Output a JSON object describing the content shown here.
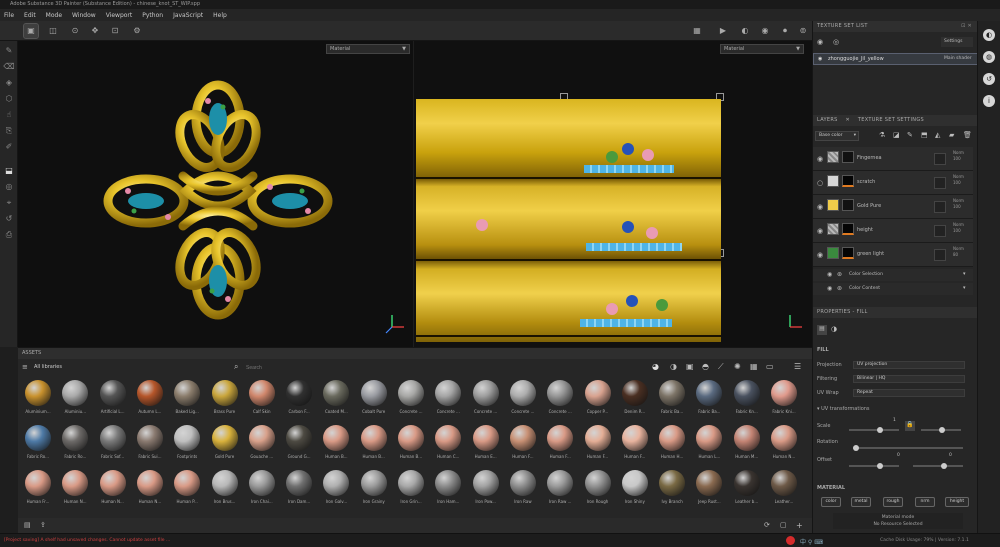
{
  "window": {
    "title": "Adobe Substance 3D Painter (Substance Edition) - chinese_knot_ST_WIP.spp"
  },
  "menu": [
    "File",
    "Edit",
    "Mode",
    "Window",
    "Viewport",
    "Python",
    "JavaScript",
    "Help"
  ],
  "viewport3d": {
    "dropdown": "Material"
  },
  "viewport2d": {
    "dropdown": "Material"
  },
  "assets": {
    "title": "ASSETS",
    "library": "All libraries",
    "search_placeholder": "Search",
    "rows": [
      [
        "Aluminium...",
        "Aluminiu...",
        "Artificial L...",
        "Autumn L...",
        "Baked Lig...",
        "Brass Pure",
        "Calf Skin",
        "Carbon F...",
        "Coated M...",
        "Cobalt Pure",
        "Concrete ...",
        "Concrete ...",
        "Concrete ...",
        "Concrete ...",
        "Concrete ...",
        "Copper P...",
        "Denim R...",
        "Fabric Ba...",
        "Fabric Ba...",
        "Fabric Kn...",
        "Fabric Kni..."
      ],
      [
        "Fabric Ro...",
        "Fabric Ro...",
        "Fabric Sof...",
        "Fabric Sui...",
        "Footprints",
        "Gold Pure",
        "Gouache ...",
        "Ground G...",
        "Human B...",
        "Human B...",
        "Human B...",
        "Human C...",
        "Human E...",
        "Human F...",
        "Human F...",
        "Human F...",
        "Human F...",
        "Human H...",
        "Human L...",
        "Human M...",
        "Human N..."
      ],
      [
        "Human Fr...",
        "Human N...",
        "Human N...",
        "Human N...",
        "Human P...",
        "Iron Brus...",
        "Iron Chai...",
        "Iron Dam...",
        "Iron Galv...",
        "Iron Grainy",
        "Iron Grin...",
        "Iron Ham...",
        "Iron Pow...",
        "Iron Raw",
        "Iron Raw ...",
        "Iron Rough",
        "Iron Shiny",
        "Ivy Branch",
        "Jeep Rust...",
        "Leather b...",
        "Leather..."
      ]
    ]
  },
  "texture_set_list": {
    "title": "TEXTURE SET LIST",
    "settings": "Settings",
    "item_name": "zhongguojie_Jil_yellow",
    "item_shader": "Main shader"
  },
  "layers": {
    "tab1": "LAYERS",
    "tab2": "TEXTURE SET SETTINGS",
    "channel": "Base color",
    "items": [
      {
        "name": "Fingernea",
        "blend": "Norm",
        "opacity": "100"
      },
      {
        "name": "scratch",
        "blend": "Norm",
        "opacity": "100"
      },
      {
        "name": "Gold Pure",
        "blend": "Norm",
        "opacity": "100"
      },
      {
        "name": "height",
        "blend": "Norm",
        "opacity": "100"
      },
      {
        "name": "green light",
        "blend": "Norm",
        "opacity": "80"
      }
    ],
    "effects": [
      "Color Selection",
      "Color Content"
    ]
  },
  "properties": {
    "tab": "PROPERTIES - FILL",
    "section": "FILL",
    "projection_label": "Projection",
    "projection_value": "UV projection",
    "filtering_label": "Filtering",
    "filtering_value": "Bilinear | HQ",
    "uvwrap_label": "UV Wrap",
    "uvwrap_value": "Repeat",
    "uvtrans": "UV transformations",
    "scale_label": "Scale",
    "scale_value": "1",
    "rotation_label": "Rotation",
    "offset_label": "Offset",
    "offset_x": "0",
    "offset_y": "0",
    "material": "MATERIAL",
    "mat_buttons": [
      "color",
      "metal",
      "rough",
      "nrm",
      "height"
    ],
    "mat_mode": "Material mode",
    "mat_none": "No Resource Selected"
  },
  "status": {
    "message": "[Project saving] A shelf had unsaved changes. Cannot update asset file ...",
    "right": "Cache Disk Usage: 79% | Version: 7.1.1"
  }
}
